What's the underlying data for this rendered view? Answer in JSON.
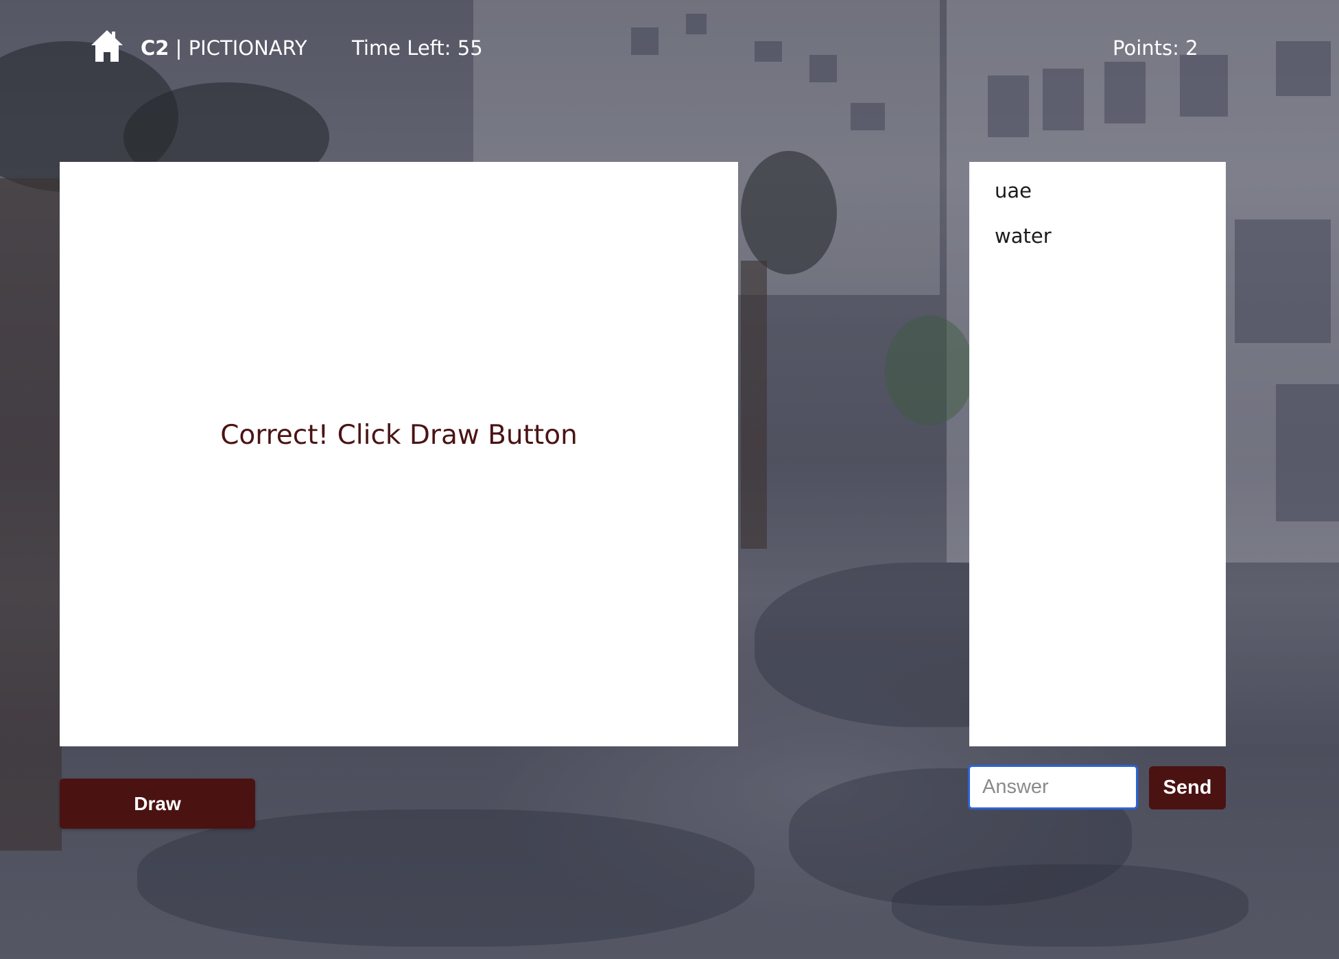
{
  "header": {
    "home_icon": "home-icon",
    "brand_code": "C2",
    "brand_separator": " | ",
    "brand_name": "PICTIONARY",
    "time_label": "Time Left: 55",
    "points_label": "Points: 2"
  },
  "canvas": {
    "message": "Correct! Click Draw Button"
  },
  "guesses": {
    "items": [
      "uae",
      "water"
    ]
  },
  "controls": {
    "draw_label": "Draw",
    "answer_placeholder": "Answer",
    "answer_value": "",
    "send_label": "Send"
  },
  "colors": {
    "accent": "#4b1212",
    "message_text": "#4a1414",
    "input_focus": "#2c64d6"
  }
}
